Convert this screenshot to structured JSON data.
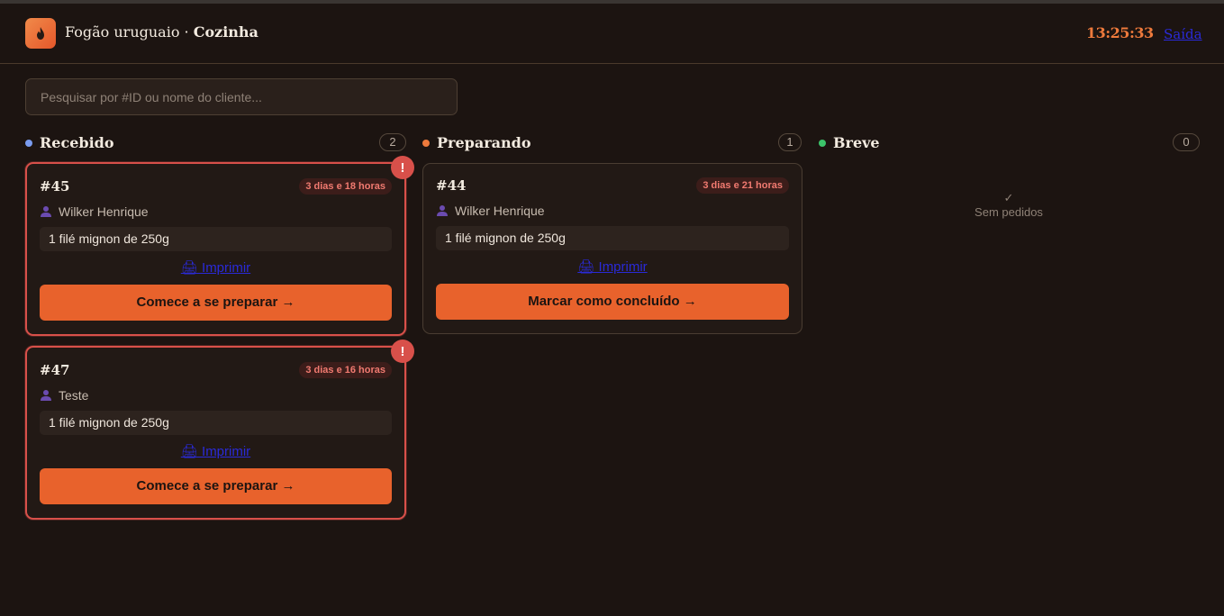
{
  "header": {
    "app_name": "Fogão uruguaio",
    "separator": " · ",
    "section": "Cozinha",
    "clock": "13:25:33",
    "logout_label": "Saída"
  },
  "search": {
    "placeholder": "Pesquisar por #ID ou nome do cliente..."
  },
  "columns": [
    {
      "title": "Recebido",
      "count": "2",
      "dot_color": "#7a9cf0",
      "orders": [
        {
          "id": "#45",
          "age": "3 dias e 18 horas",
          "customer": "Wilker Henrique",
          "item": "1 filé mignon de 250g",
          "print_label": "🖨 Imprimir",
          "action_label": "Comece a se preparar →",
          "alert": "!"
        },
        {
          "id": "#47",
          "age": "3 dias e 16 horas",
          "customer": "Teste",
          "item": "1 filé mignon de 250g",
          "print_label": "🖨 Imprimir",
          "action_label": "Comece a se preparar →",
          "alert": "!"
        }
      ]
    },
    {
      "title": "Preparando",
      "count": "1",
      "dot_color": "#ee7a3c",
      "orders": [
        {
          "id": "#44",
          "age": "3 dias e 21 horas",
          "customer": "Wilker Henrique",
          "item": "1 filé mignon de 250g",
          "print_label": "🖨 Imprimir",
          "action_label": "Marcar como concluído →"
        }
      ]
    },
    {
      "title": "Breve",
      "count": "0",
      "dot_color": "#3cc46a",
      "empty_icon": "✓",
      "empty_text": "Sem pedidos"
    }
  ],
  "colors": {
    "background": "#1c1411",
    "accent": "#e8622c",
    "alert": "#d8504a"
  },
  "icons": [
    "flame-icon",
    "user-icon",
    "printer-icon",
    "check-icon",
    "alert-icon"
  ]
}
